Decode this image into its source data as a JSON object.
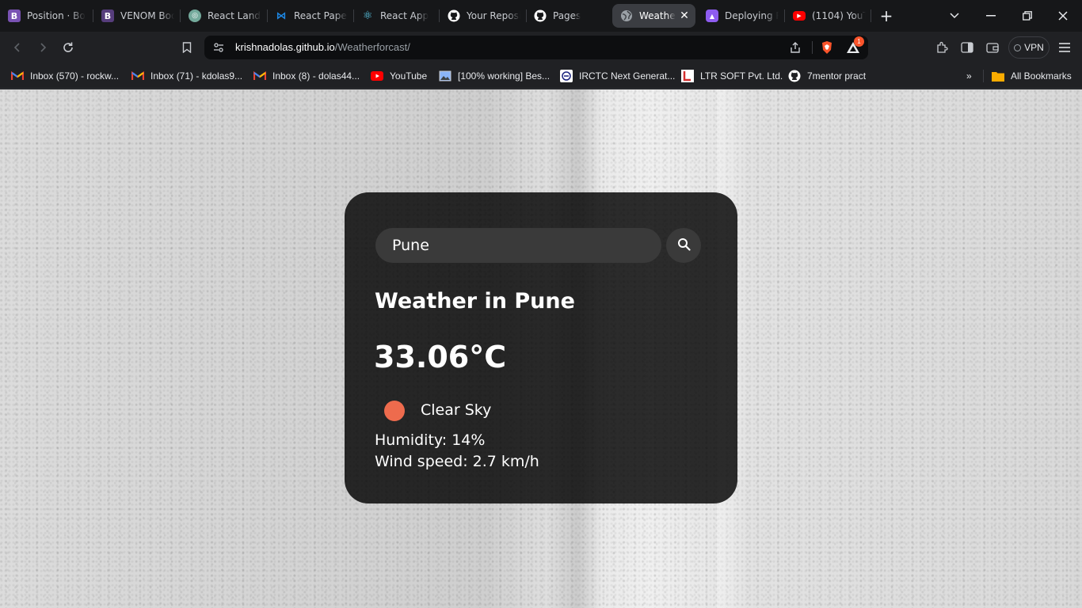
{
  "browser": {
    "tabs": [
      {
        "title": "Position · Bo",
        "icon": "bootstrap-icon",
        "color": "#7952b3",
        "glyph": "B"
      },
      {
        "title": "VENOM Boo",
        "icon": "bootstrap-icon",
        "color": "#563d7c",
        "glyph": "B"
      },
      {
        "title": "React Landin",
        "icon": "openai-icon",
        "color": "#74aa9c",
        "glyph": "◎"
      },
      {
        "title": "React Paper",
        "icon": "mui-icon",
        "color": "#1976d2",
        "glyph": "⋈"
      },
      {
        "title": "React App",
        "icon": "react-icon",
        "color": "#61dafb",
        "glyph": "⚛"
      },
      {
        "title": "Your Reposi",
        "icon": "github-icon",
        "color": "#ffffff",
        "glyph": "●"
      },
      {
        "title": "Pages",
        "icon": "github-icon",
        "color": "#ffffff",
        "glyph": "●"
      },
      {
        "title": "Weathe",
        "icon": "globe-icon",
        "color": "#9aa0a6",
        "glyph": "◍",
        "active": true
      },
      {
        "title": "Deploying R",
        "icon": "deploy-icon",
        "color": "#8e5cf0",
        "glyph": "▲"
      },
      {
        "title": "(1104) YouT",
        "icon": "youtube-icon",
        "color": "#ff0000",
        "glyph": "▶"
      }
    ],
    "url_domain": "krishnadolas.github.io",
    "url_path": "/Weatherforcast/",
    "vpn_label": "VPN",
    "brave_badge": "1"
  },
  "bookmarks": [
    {
      "label": "Inbox (570) - rockw...",
      "icon": "gmail-icon"
    },
    {
      "label": "Inbox (71) - kdolas9...",
      "icon": "gmail-icon"
    },
    {
      "label": "Inbox (8) - dolas44...",
      "icon": "gmail-icon"
    },
    {
      "label": "YouTube",
      "icon": "youtube-icon"
    },
    {
      "label": "[100% working] Bes...",
      "icon": "image-icon"
    },
    {
      "label": "IRCTC Next Generat...",
      "icon": "irctc-icon"
    },
    {
      "label": "LTR SOFT Pvt. Ltd.",
      "icon": "ltr-icon"
    },
    {
      "label": "7mentor pract",
      "icon": "github-icon"
    }
  ],
  "all_bookmarks_label": "All Bookmarks",
  "weather": {
    "search_value": "Pune",
    "title": "Weather in Pune",
    "temperature": "33.06°C",
    "condition": "Clear Sky",
    "humidity": "Humidity: 14%",
    "wind": "Wind speed: 2.7 km/h",
    "condition_icon_color": "#ee6b4d"
  }
}
